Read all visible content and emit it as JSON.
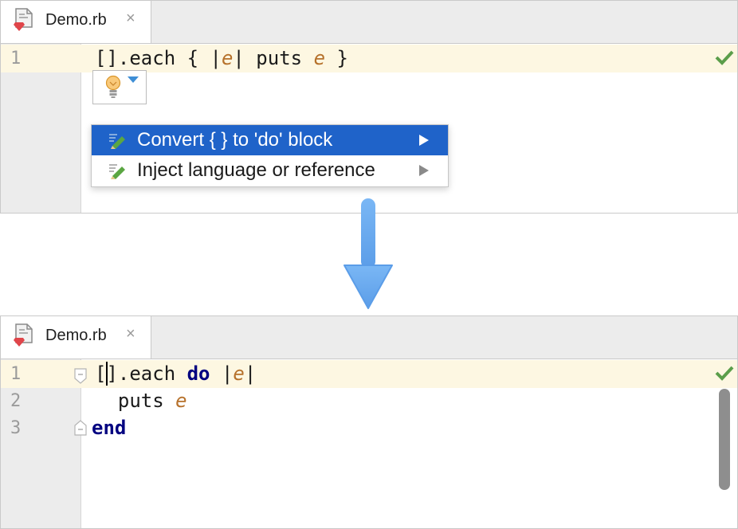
{
  "top_editor": {
    "tab": {
      "title": "Demo.rb",
      "close_glyph": "×",
      "icon": "ruby-file-icon"
    },
    "lines": [
      {
        "number": "1",
        "code": [
          "[].each { |",
          "e",
          "| puts ",
          "e",
          " }"
        ]
      }
    ],
    "status_icon": "check-icon",
    "intention_bulb": {
      "icon": "lightbulb-icon",
      "dropdown": "triangle-down-icon"
    },
    "popup": {
      "items": [
        {
          "label": "Convert { } to 'do' block",
          "selected": true,
          "icon": "pencil-icon",
          "submenu": "arrow-right-icon"
        },
        {
          "label": "Inject language or reference",
          "selected": false,
          "icon": "pencil-icon",
          "submenu": "arrow-right-icon"
        }
      ]
    }
  },
  "transition_arrow": {
    "icon": "arrow-down-icon",
    "color": "#6aaaf0"
  },
  "bottom_editor": {
    "tab": {
      "title": "Demo.rb",
      "close_glyph": "×",
      "icon": "ruby-file-icon"
    },
    "lines": [
      {
        "number": "1",
        "code": [
          "[]",
          ".each ",
          "do",
          " |",
          "e",
          "|"
        ]
      },
      {
        "number": "2",
        "code": [
          "  puts ",
          "e"
        ]
      },
      {
        "number": "3",
        "code": [
          "end"
        ]
      }
    ],
    "status_icon": "check-icon"
  },
  "colors": {
    "selection": "#1f63c9",
    "line_highlight": "#fdf7e2",
    "variable": "#b6712b",
    "keyword": "#000080",
    "check": "#5b9e4a"
  }
}
